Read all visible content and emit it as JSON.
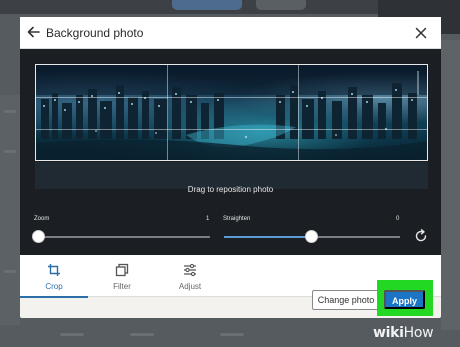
{
  "modal": {
    "title": "Background photo",
    "drag_hint": "Drag to reposition photo"
  },
  "sliders": {
    "zoom": {
      "label": "Zoom",
      "value_text": "1",
      "level": 0
    },
    "straighten": {
      "label": "Straighten",
      "value_text": "0",
      "level": 0.5
    }
  },
  "tabs": [
    {
      "label": "Crop",
      "icon": "crop-icon",
      "active": true
    },
    {
      "label": "Filter",
      "icon": "filter-icon",
      "active": false
    },
    {
      "label": "Adjust",
      "icon": "adjust-icon",
      "active": false
    }
  ],
  "footer": {
    "change_label": "Change photo",
    "apply_label": "Apply"
  },
  "colors": {
    "accent": "#2b6ea8",
    "apply_button": "#1b74c4",
    "highlight": "#22d822"
  },
  "watermark": {
    "wiki": "wiki",
    "how": "How"
  }
}
